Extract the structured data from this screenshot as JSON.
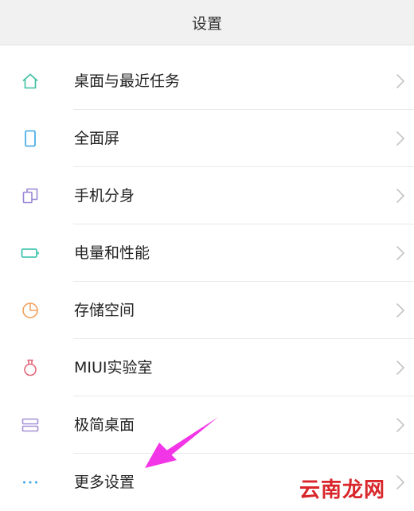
{
  "header": {
    "title": "设置"
  },
  "items": [
    {
      "label": "桌面与最近任务",
      "icon": "home-icon",
      "color": "#3dbfa0"
    },
    {
      "label": "全面屏",
      "icon": "phone-icon",
      "color": "#3aa3e3"
    },
    {
      "label": "手机分身",
      "icon": "dual-apps-icon",
      "color": "#9a87d6"
    },
    {
      "label": "电量和性能",
      "icon": "battery-icon",
      "color": "#2ebfa6"
    },
    {
      "label": "存储空间",
      "icon": "storage-pie-icon",
      "color": "#f0a261"
    },
    {
      "label": "MIUI实验室",
      "icon": "lab-flask-icon",
      "color": "#e2677a"
    },
    {
      "label": "极简桌面",
      "icon": "simple-home-icon",
      "color": "#a491d8"
    },
    {
      "label": "更多设置",
      "icon": "more-dots-icon",
      "color": "#3aa3e3"
    }
  ],
  "annotation": {
    "arrow_color": "#f235e6"
  },
  "watermark": {
    "text": "云南龙网",
    "color": "#d8262a"
  }
}
